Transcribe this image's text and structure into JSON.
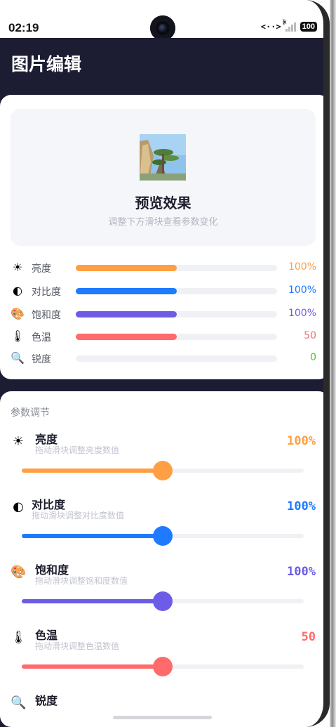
{
  "status": {
    "time": "02:19",
    "link_icon": "<··>",
    "battery": "100"
  },
  "header": {
    "title": "图片编辑"
  },
  "preview": {
    "title": "预览效果",
    "subtitle": "调整下方滑块查看参数变化"
  },
  "summary": [
    {
      "icon": "sun-icon",
      "glyph": "☀",
      "label": "亮度",
      "value": "100%",
      "fraction": 0.5,
      "color": "#ff9f43"
    },
    {
      "icon": "contrast-icon",
      "glyph": "◐",
      "label": "对比度",
      "value": "100%",
      "fraction": 0.5,
      "color": "#1e7bff"
    },
    {
      "icon": "palette-icon",
      "glyph": "🎨",
      "label": "饱和度",
      "value": "100%",
      "fraction": 0.5,
      "color": "#6c5ce7"
    },
    {
      "icon": "thermometer-icon",
      "glyph": "🌡",
      "label": "色温",
      "value": "50",
      "fraction": 0.5,
      "color": "#ff6b6b"
    },
    {
      "icon": "magnifier-icon",
      "glyph": "🔍",
      "label": "锐度",
      "value": "0",
      "fraction": 0.0,
      "color": "#52c41a"
    }
  ],
  "controls_section": {
    "title": "参数调节"
  },
  "controls": [
    {
      "icon": "sun-icon",
      "glyph": "☀",
      "name": "亮度",
      "desc": "拖动滑块调整亮度数值",
      "value": "100%",
      "fraction": 0.5,
      "color": "#ff9f43"
    },
    {
      "icon": "contrast-icon",
      "glyph": "◐",
      "name": "对比度",
      "desc": "拖动滑块调整对比度数值",
      "value": "100%",
      "fraction": 0.5,
      "color": "#1e7bff"
    },
    {
      "icon": "palette-icon",
      "glyph": "🎨",
      "name": "饱和度",
      "desc": "拖动滑块调整饱和度数值",
      "value": "100%",
      "fraction": 0.5,
      "color": "#6c5ce7"
    },
    {
      "icon": "thermometer-icon",
      "glyph": "🌡",
      "name": "色温",
      "desc": "拖动滑块调整色温数值",
      "value": "50",
      "fraction": 0.5,
      "color": "#ff6b6b"
    },
    {
      "icon": "magnifier-icon",
      "glyph": "🔍",
      "name": "锐度",
      "desc": "",
      "value": "",
      "fraction": 0.0,
      "color": "#52c41a"
    }
  ]
}
